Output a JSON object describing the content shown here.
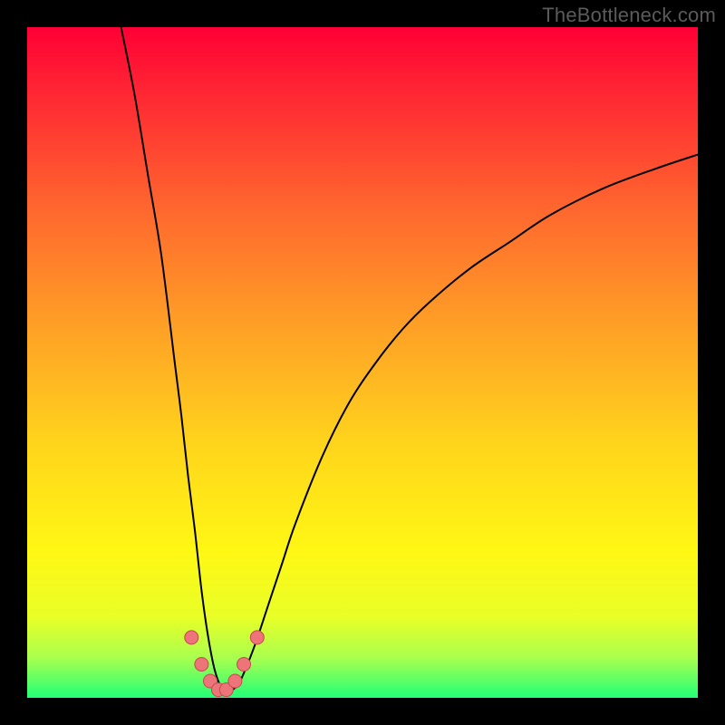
{
  "watermark": "TheBottleneck.com",
  "colors": {
    "gradient_stops": [
      {
        "offset": "0%",
        "color": "#ff0035"
      },
      {
        "offset": "12%",
        "color": "#ff2f33"
      },
      {
        "offset": "28%",
        "color": "#ff6a2e"
      },
      {
        "offset": "45%",
        "color": "#ffa126"
      },
      {
        "offset": "62%",
        "color": "#ffd41c"
      },
      {
        "offset": "78%",
        "color": "#fff714"
      },
      {
        "offset": "88%",
        "color": "#e8ff27"
      },
      {
        "offset": "94%",
        "color": "#aaff4e"
      },
      {
        "offset": "100%",
        "color": "#22ff77"
      }
    ],
    "curve_stroke": "#000000",
    "marker_fill": "#ed7579",
    "marker_stroke": "#c4484c",
    "frame_bg": "#000000"
  },
  "chart_data": {
    "type": "line",
    "title": "",
    "xlabel": "",
    "ylabel": "",
    "xlim": [
      0,
      100
    ],
    "ylim": [
      0,
      100
    ],
    "note": "y ≈ bottleneck % (0 at bottom/green, 100 at top/red); x is relative component-balance axis. Values estimated from pixel positions.",
    "series": [
      {
        "name": "bottleneck-curve",
        "x": [
          14,
          16,
          18,
          20,
          22,
          23,
          24,
          25,
          26,
          27,
          28,
          29,
          30,
          31,
          32,
          34,
          36,
          38,
          40,
          44,
          48,
          52,
          56,
          60,
          66,
          72,
          78,
          86,
          94,
          100
        ],
        "y": [
          100,
          90,
          78,
          66,
          50,
          42,
          33,
          25,
          16,
          9,
          4,
          1.5,
          1,
          1.5,
          3,
          8,
          14,
          20,
          26,
          36,
          44,
          50,
          55,
          59,
          64,
          68,
          72,
          76,
          79,
          81
        ]
      }
    ],
    "markers": {
      "name": "highlighted-points",
      "x": [
        24.5,
        26,
        27.3,
        28.5,
        29.7,
        31,
        32.3,
        34.3
      ],
      "y": [
        9,
        5,
        2.5,
        1.2,
        1.2,
        2.5,
        5,
        9
      ]
    }
  }
}
